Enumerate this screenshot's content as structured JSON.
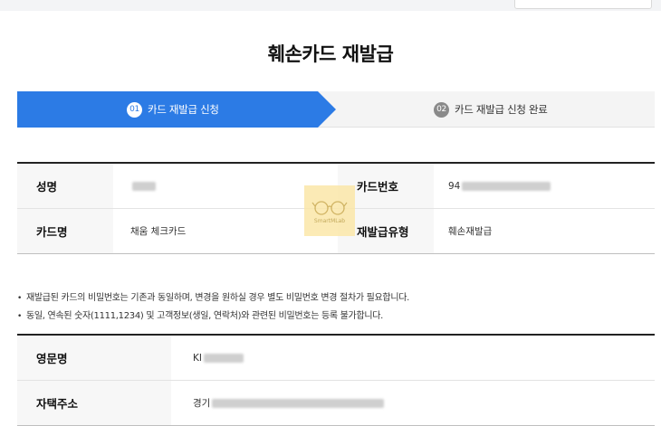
{
  "page": {
    "title": "훼손카드 재발급"
  },
  "steps": [
    {
      "number": "01",
      "label": "카드 재발급 신청",
      "state": "active"
    },
    {
      "number": "02",
      "label": "카드 재발급 신청 완료",
      "state": "inactive"
    }
  ],
  "card_info": {
    "name_label": "성명",
    "name_value": "",
    "card_number_label": "카드번호",
    "card_number_value": "94",
    "card_name_label": "카드명",
    "card_name_value": "채움 체크카드",
    "reissue_type_label": "재발급유형",
    "reissue_type_value": "훼손재발급"
  },
  "notes": [
    "재발급된 카드의 비밀번호는 기존과 동일하며, 변경을 원하실 경우 별도 비밀번호 변경 절차가 필요합니다.",
    "동일, 연속된 숫자(1111,1234) 및 고객정보(생일, 연락처)와 관련된 비밀번호는 등록 불가합니다."
  ],
  "applicant": {
    "english_name_label": "영문명",
    "english_name_value": "KI",
    "address_label": "자택주소",
    "address_value": "경기"
  },
  "watermark": {
    "text": "SmartMLab",
    "icon": "glasses-icon"
  },
  "colors": {
    "accent": "#2c7be5",
    "step_inactive": "#8a8a8a",
    "header_bg": "#f7f7f7"
  }
}
